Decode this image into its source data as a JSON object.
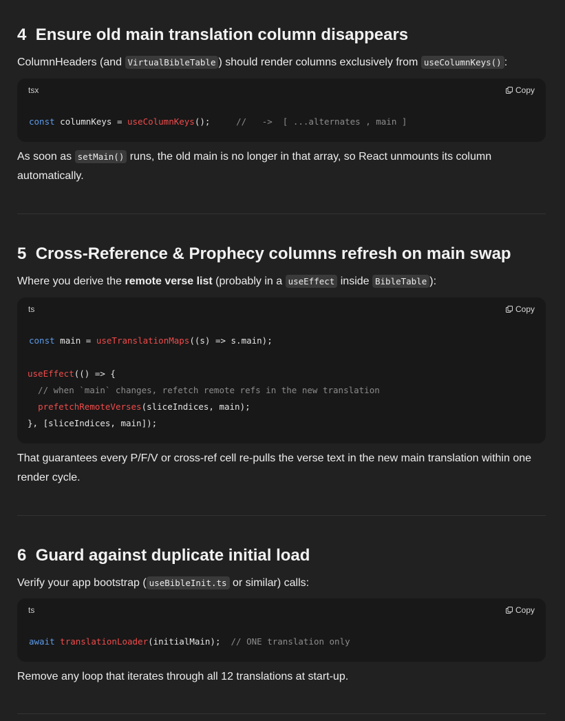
{
  "section4": {
    "num": "4",
    "title": "Ensure old main translation column disappears",
    "intro": {
      "t1": "ColumnHeaders (and ",
      "code1": "VirtualBibleTable",
      "t2": ") should render columns exclusively from ",
      "code2": "useColumnKeys()",
      "t3": ":"
    },
    "code_block": {
      "lang": "tsx",
      "copy": "Copy",
      "line1": {
        "kw": "const",
        "var": " columnKeys = ",
        "fn": "useColumnKeys",
        "rest": "();     ",
        "comment": "//   ->  [ ...alternates , main ]"
      }
    },
    "after": {
      "t1": "As soon as ",
      "code1": "setMain()",
      "t2": " runs, the old main is no longer in that array, so React unmounts its column automatically."
    }
  },
  "section5": {
    "num": "5",
    "title": "Cross-Reference & Prophecy columns refresh on main swap",
    "intro": {
      "t1": "Where you derive the ",
      "bold": "remote verse list",
      "t2": " (probably in a ",
      "code1": "useEffect",
      "t3": " inside ",
      "code2": "BibleTable",
      "t4": "):"
    },
    "code_block": {
      "lang": "ts",
      "copy": "Copy",
      "line1": {
        "kw": "const",
        "var": " main = ",
        "fn": "useTranslationMaps",
        "rest": "((s) => s.main);"
      },
      "line2": {
        "fn": "useEffect",
        "rest": "(() => {"
      },
      "line3": {
        "comment": "  // when `main` changes, refetch remote refs in the new translation"
      },
      "line4": {
        "indent": "  ",
        "fn": "prefetchRemoteVerses",
        "rest": "(sliceIndices, main);"
      },
      "line5": {
        "rest": "}, [sliceIndices, main]);"
      }
    },
    "after": "That guarantees every P/F/V or cross-ref cell re-pulls the verse text in the new main translation within one render cycle."
  },
  "section6": {
    "num": "6",
    "title": "Guard against duplicate initial load",
    "intro": {
      "t1": "Verify your app bootstrap (",
      "code1": "useBibleInit.ts",
      "t2": " or similar) calls:"
    },
    "code_block": {
      "lang": "ts",
      "copy": "Copy",
      "line1": {
        "kw": "await",
        "sp": " ",
        "fn": "translationLoader",
        "rest": "(initialMain);  ",
        "comment": "// ONE translation only"
      }
    },
    "after": "Remove any loop that iterates through all 12 translations at start-up."
  },
  "icons": {
    "copy": "copy-icon"
  },
  "colors": {
    "background": "#212121",
    "code_background": "#181818",
    "keyword": "#5d9bea",
    "function": "#f04b4b",
    "comment": "#8c8c8c"
  }
}
